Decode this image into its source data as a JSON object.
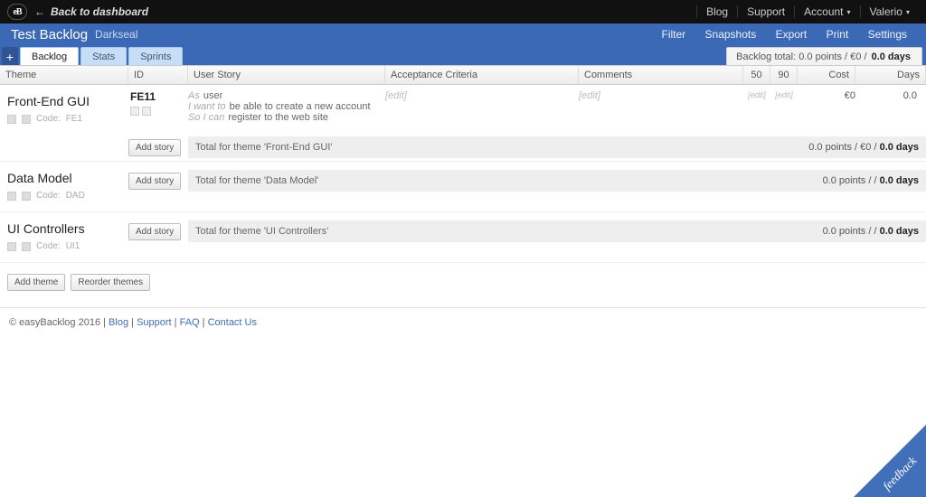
{
  "topbar": {
    "back": "Back to dashboard",
    "menu": [
      "Blog",
      "Support",
      "Account",
      "Valerio"
    ]
  },
  "bluebar": {
    "title": "Test Backlog",
    "subtitle": "Darkseal",
    "actions": [
      "Filter",
      "Snapshots",
      "Export",
      "Print",
      "Settings"
    ]
  },
  "tabs": {
    "plus": "+",
    "items": [
      "Backlog",
      "Stats",
      "Sprints"
    ],
    "active": 0
  },
  "backlog_total": {
    "label": "Backlog total:",
    "points": "0.0 points",
    "sep": "/",
    "cost": "€0",
    "sep2": "/",
    "days": "0.0 days"
  },
  "headers": {
    "theme": "Theme",
    "id": "ID",
    "story": "User Story",
    "accept": "Acceptance Criteria",
    "comments": "Comments",
    "p50": "50",
    "p90": "90",
    "cost": "Cost",
    "days": "Days"
  },
  "themes": [
    {
      "name": "Front-End GUI",
      "code": "FE1",
      "story": {
        "id": "FE11",
        "as_label": "As",
        "as_val": "user",
        "want_label": "I want to",
        "want_val": "be able to create a new account",
        "so_label": "So I can",
        "so_val": "register to the web site",
        "accept": "[edit]",
        "comments": "[edit]",
        "p50": "[edit]",
        "p90": "[edit]",
        "cost": "€0",
        "days": "0.0"
      },
      "total": "Total for theme 'Front-End GUI'",
      "total_right": {
        "p": "0.0 points",
        "a": "/",
        "c": "€0",
        "b": "/",
        "d": "0.0 days"
      },
      "add": "Add story"
    },
    {
      "name": "Data Model",
      "code": "DAD",
      "total": "Total for theme 'Data Model'",
      "total_right": {
        "p": "0.0 points",
        "a": "/",
        "c": "",
        "b": "/",
        "d": "0.0 days"
      },
      "add": "Add story"
    },
    {
      "name": "UI Controllers",
      "code": "UI1",
      "total": "Total for theme 'UI Controllers'",
      "total_right": {
        "p": "0.0 points",
        "a": "/",
        "c": "",
        "b": "/",
        "d": "0.0 days"
      },
      "add": "Add story"
    }
  ],
  "buttons": {
    "add_theme": "Add theme",
    "reorder": "Reorder themes"
  },
  "footer": {
    "copy": "© easyBacklog 2016",
    "links": [
      "Blog",
      "Support",
      "FAQ",
      "Contact Us"
    ]
  },
  "feedback": "feedback",
  "code_label": "Code:"
}
